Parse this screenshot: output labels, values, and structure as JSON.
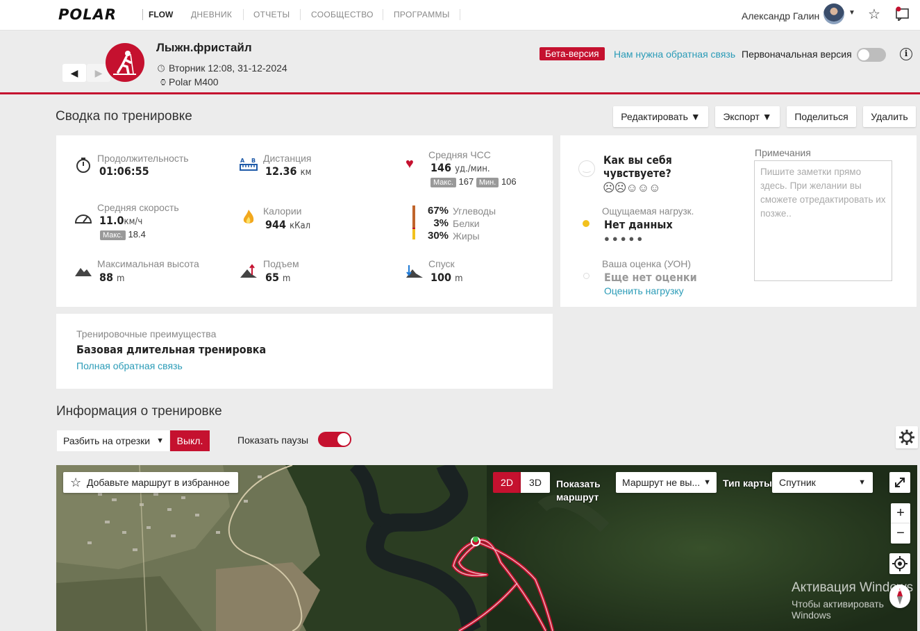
{
  "nav": {
    "logo": "POLAR",
    "flow": "FLOW",
    "items": [
      "ДНЕВНИК",
      "ОТЧЕТЫ",
      "СООБЩЕСТВО",
      "ПРОГРАММЫ"
    ],
    "user_name": "Александр Галин"
  },
  "header": {
    "prev": "◀",
    "next": "▶",
    "title": "Лыжн.фристайл",
    "datetime": "Вторник 12:08, 31-12-2024",
    "device": "Polar M400",
    "beta_badge": "Бета-версия",
    "feedback_link": "Нам нужна обратная связь",
    "original_version": "Первоначальная версия",
    "original_version_on": false,
    "info": "i"
  },
  "summary": {
    "title": "Сводка по тренировке",
    "buttons": {
      "edit": "Редактировать",
      "export": "Экспорт",
      "share": "Поделиться",
      "delete": "Удалить"
    },
    "duration": {
      "label": "Продолжительность",
      "value": "01:06:55"
    },
    "distance": {
      "label": "Дистанция",
      "value": "12.36",
      "unit": "км"
    },
    "hr": {
      "label": "Средняя ЧСС",
      "value": "146",
      "unit": "уд./мин.",
      "max_label": "Макс.",
      "max": "167",
      "min_label": "Мин.",
      "min": "106"
    },
    "speed": {
      "label": "Средняя скорость",
      "value": "11.0",
      "unit": "км/ч",
      "max_label": "Макс.",
      "max": "18.4"
    },
    "calories": {
      "label": "Калории",
      "value": "944",
      "unit": "кКал"
    },
    "macros": [
      {
        "pct": "67%",
        "name": "Углеводы",
        "color": "#c0652b"
      },
      {
        "pct": "3%",
        "name": "Белки",
        "color": "#c5112f"
      },
      {
        "pct": "30%",
        "name": "Жиры",
        "color": "#f2c11d"
      }
    ],
    "max_alt": {
      "label": "Максимальная высота",
      "value": "88",
      "unit": "m"
    },
    "ascent": {
      "label": "Подъем",
      "value": "65",
      "unit": "m"
    },
    "descent": {
      "label": "Спуск",
      "value": "100",
      "unit": "m"
    }
  },
  "feeling": {
    "question": "Как вы себя чувствуете?",
    "perceived_label": "Ощущаемая нагрузк.",
    "perceived_value": "Нет данных",
    "rpe_label": "Ваша оценка (УОН)",
    "rpe_value": "Еще нет оценки",
    "rpe_link": "Оценить нагрузку",
    "notes_label": "Примечания",
    "notes_placeholder": "Пишите заметки прямо здесь. При желании вы сможете отредактировать их позже.."
  },
  "benefit": {
    "label": "Тренировочные преимущества",
    "value": "Базовая длительная тренировка",
    "link": "Полная обратная связь"
  },
  "info": {
    "title": "Информация о тренировке",
    "split_select": "Разбить на отрезки",
    "split_off": "Выкл.",
    "show_pauses": "Показать паузы",
    "show_pauses_on": true
  },
  "map": {
    "favorite": "Добавьте маршрут в избранное",
    "mode_2d": "2D",
    "mode_3d": "3D",
    "show_route_1": "Показать",
    "show_route_2": "маршрут",
    "route_select": "Маршрут не вы...",
    "map_type_label": "Тип карты",
    "map_type_value": "Спутник",
    "zoom_in": "+",
    "zoom_out": "−",
    "watermark_1": "Активация Windows",
    "watermark_2": "Чтобы активировать Windows"
  },
  "colors": {
    "accent": "#c5112f",
    "link": "#2a9bb7"
  }
}
